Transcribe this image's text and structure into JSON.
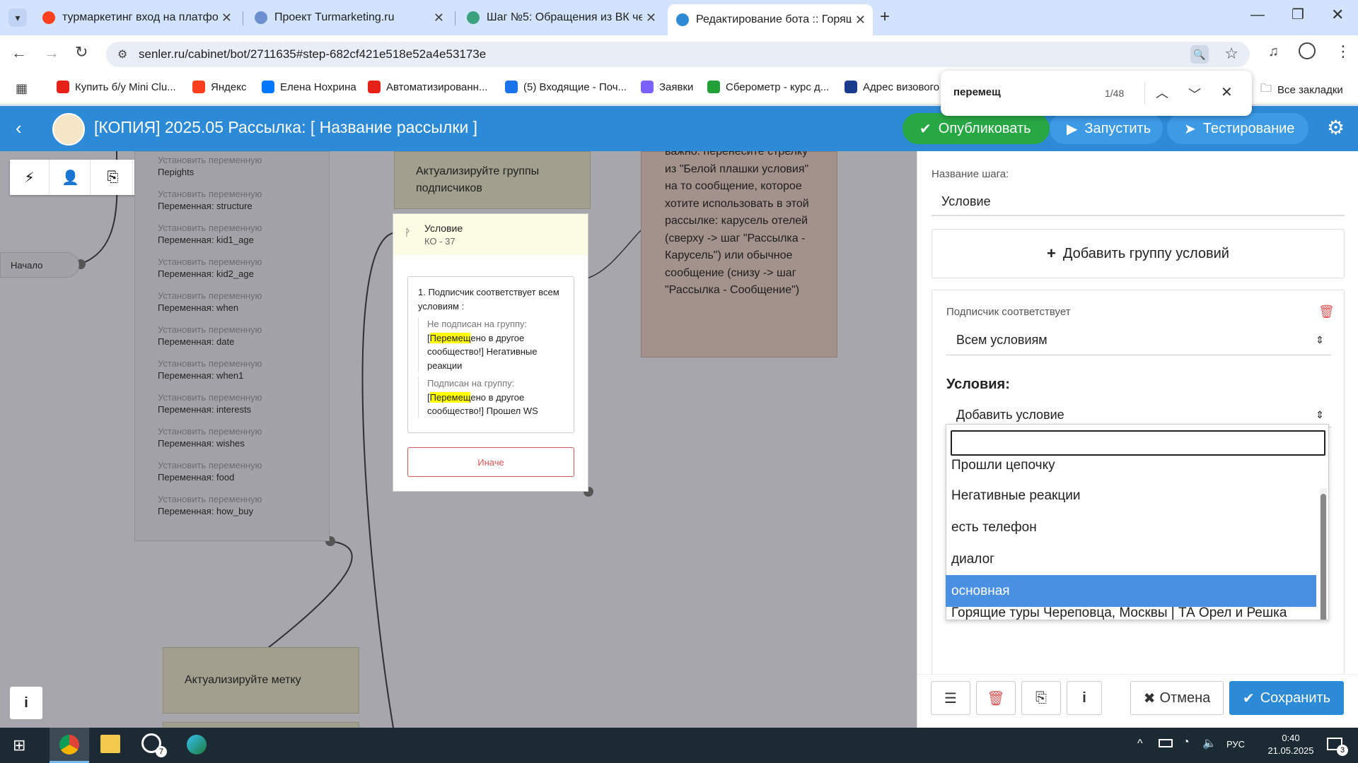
{
  "browser": {
    "tabs": [
      {
        "title": "турмаркетинг вход на платфо",
        "favicon_color": "#fc3f1d"
      },
      {
        "title": "Проект Turmarketing.ru",
        "favicon_color": "#1a73e8"
      },
      {
        "title": "Шаг №5: Обращения из ВК че",
        "favicon_color": "#1a73e8"
      },
      {
        "title": "Редактирование бота :: Горящ",
        "favicon_color": "#2d8ad6",
        "active": true
      }
    ],
    "url": "senler.ru/cabinet/bot/2711635#step-682cf421e518e52a4e53173e",
    "bookmarks": [
      {
        "label": "Купить б/у Mini Clu...",
        "color": "#e62117"
      },
      {
        "label": "Яндекс",
        "color": "#fc3f1d"
      },
      {
        "label": "Елена Нохрина",
        "color": "#0077ff"
      },
      {
        "label": "Автоматизированн...",
        "color": "#e62117"
      },
      {
        "label": "(5) Входящие - Поч...",
        "color": "#1a73e8"
      },
      {
        "label": "Заявки",
        "color": "#7b61ff"
      },
      {
        "label": "Сберометр - курс д...",
        "color": "#21a038"
      },
      {
        "label": "Адрес визового",
        "color": "#1a3c8f"
      }
    ],
    "all_bookmarks": "Все закладки"
  },
  "findbar": {
    "query": "перемещ",
    "count": "1/48"
  },
  "header": {
    "title": "[КОПИЯ] 2025.05 Рассылка: [ Название рассылки ]",
    "publish": "Опубликовать",
    "run": "Запустить",
    "test": "Тестирование"
  },
  "canvas": {
    "start_label": "Начало",
    "variables": [
      {
        "label": "Установить переменную",
        "value": "ights"
      },
      {
        "label": "Установить переменную",
        "value": "Переменная: structure"
      },
      {
        "label": "Установить переменную",
        "value": "Переменная: kid1_age"
      },
      {
        "label": "Установить переменную",
        "value": "Переменная: kid2_age"
      },
      {
        "label": "Установить переменную",
        "value": "Переменная: when"
      },
      {
        "label": "Установить переменную",
        "value": "Переменная: date"
      },
      {
        "label": "Установить переменную",
        "value": "Переменная: when1"
      },
      {
        "label": "Установить переменную",
        "value": "Переменная: interests"
      },
      {
        "label": "Установить переменную",
        "value": "Переменная: wishes"
      },
      {
        "label": "Установить переменную",
        "value": "Переменная: food"
      },
      {
        "label": "Установить переменную",
        "value": "Переменная: how_buy"
      }
    ],
    "note_groups": "Актуализируйте группы подписчиков",
    "note_tag": "Актуализируйте метку",
    "note_important_top": "важно: перенесите стрелку",
    "note_important": "из \"Белой плашки условия\" на то сообщение, которое хотите использовать в этой рассылке: карусель отелей (сверху -> шаг \"Рассылка - Карусель\") или обычное сообщение (снизу -> шаг \"Рассылка - Сообщение\")",
    "condition": {
      "title": "Условие",
      "subtitle": "КО - 37",
      "rule_header": "1. Подписчик соответствует всем условиям :",
      "rule1_label": "Не подписан на группу:",
      "rule1_prefix": "[",
      "rule1_mark": "Перемещ",
      "rule1_rest": "ено в другое сообщество!] Негативные реакции",
      "rule2_label": "Подписан на группу:",
      "rule2_prefix": "[",
      "rule2_mark": "Перемещ",
      "rule2_rest": "ено в другое сообщество!] Прошел WS",
      "else": "Иначе"
    }
  },
  "panel": {
    "step_name_label": "Название шага:",
    "step_name_value": "Условие",
    "add_group": "Добавить группу условий",
    "subscriber_matches": "Подписчик соответствует",
    "match_mode": "Всем условиям",
    "conditions_label": "Условия:",
    "add_condition": "Добавить условие",
    "search_value": "",
    "options": [
      "Прошли цепочку",
      "Негативные реакции",
      "есть телефон",
      "диалог",
      "основная",
      "Горящие туры Череповца, Москвы | ТА Орел и Решка"
    ],
    "selected_option": "основная",
    "behind_value": "[Перемещено в другое сообщество!] Прошел WS",
    "cancel": "Отмена",
    "save": "Сохранить"
  },
  "taskbar": {
    "time": "0:40",
    "date": "21.05.2025",
    "lang": "РУС",
    "whatsapp_badge": "7",
    "notif_badge": "3"
  },
  "colors": {
    "accent": "#2d8ad6",
    "publish": "#28a745",
    "save": "#2d8ad6",
    "highlight": "#ffff00",
    "danger": "#e05555"
  }
}
